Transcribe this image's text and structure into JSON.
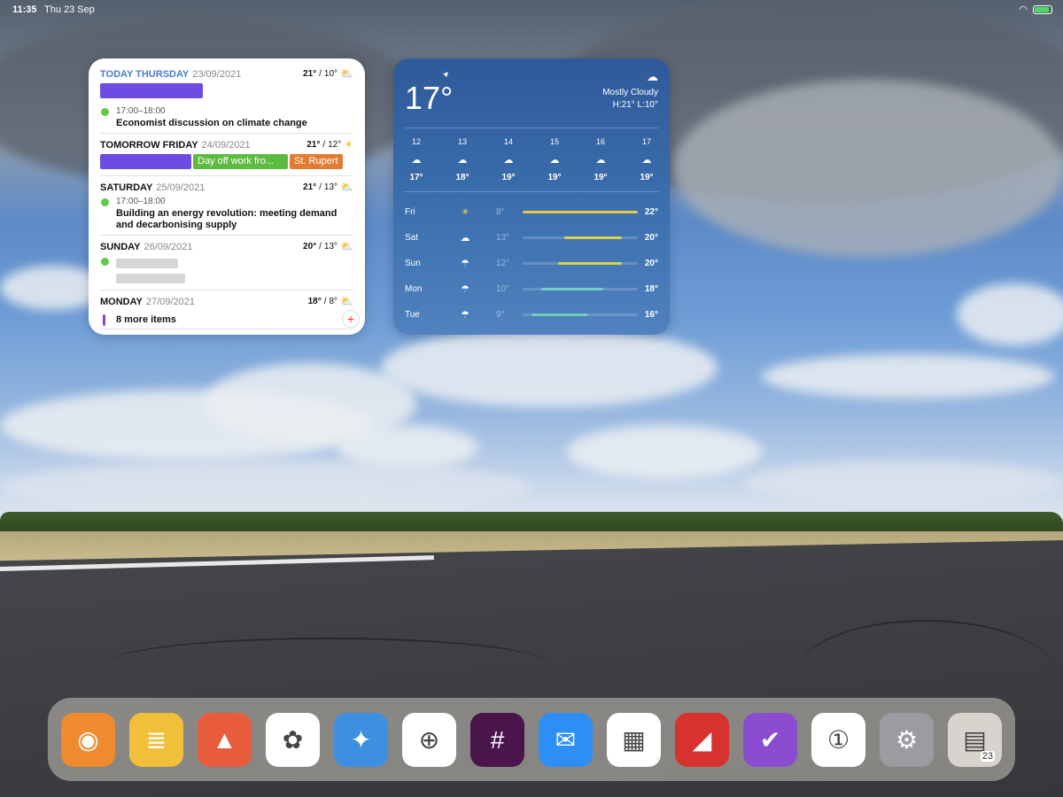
{
  "status": {
    "time": "11:35",
    "date": "Thu 23 Sep"
  },
  "calendar": {
    "days": [
      {
        "name": "TODAY THURSDAY",
        "date": "23/09/2021",
        "hi": "21°",
        "lo": "10°",
        "icon": "partly-cloudy-icon",
        "events": [
          {
            "time": "17:00–18:00",
            "title": "Economist discussion on climate change"
          }
        ]
      },
      {
        "name": "TOMORROW FRIDAY",
        "date": "24/09/2021",
        "hi": "21°",
        "lo": "12°",
        "icon": "sun-icon",
        "pills": [
          "Day off work fro...",
          "St. Rupert"
        ]
      },
      {
        "name": "SATURDAY",
        "date": "25/09/2021",
        "hi": "21°",
        "lo": "13°",
        "icon": "partly-cloudy-icon",
        "events": [
          {
            "time": "17:00–18:00",
            "title": "Building an energy revolution: meeting demand and decarbonising supply"
          }
        ]
      },
      {
        "name": "SUNDAY",
        "date": "26/09/2021",
        "hi": "20°",
        "lo": "13°",
        "icon": "partly-cloudy-icon"
      },
      {
        "name": "MONDAY",
        "date": "27/09/2021",
        "hi": "18°",
        "lo": "8°",
        "icon": "partly-cloudy-icon",
        "more": "8 more items"
      }
    ]
  },
  "weather": {
    "current": "17°",
    "condition": "Mostly Cloudy",
    "hilo": "H:21° L:10°",
    "hourly": [
      {
        "hour": "12",
        "temp": "17°"
      },
      {
        "hour": "13",
        "temp": "18°"
      },
      {
        "hour": "14",
        "temp": "19°"
      },
      {
        "hour": "15",
        "temp": "19°"
      },
      {
        "hour": "16",
        "temp": "19°"
      },
      {
        "hour": "17",
        "temp": "19°"
      }
    ],
    "daily": [
      {
        "day": "Fri",
        "lo": "8°",
        "hi": "22°",
        "icon": "sun-icon",
        "range": [
          0,
          1
        ],
        "color": "#e7c94a"
      },
      {
        "day": "Sat",
        "lo": "13°",
        "hi": "20°",
        "icon": "cloud-icon",
        "range": [
          0.36,
          0.86
        ],
        "color": "#d6d24a"
      },
      {
        "day": "Sun",
        "lo": "12°",
        "hi": "20°",
        "icon": "rain-cloud-icon",
        "range": [
          0.31,
          0.86
        ],
        "color": "#d6d24a"
      },
      {
        "day": "Mon",
        "lo": "10°",
        "hi": "18°",
        "icon": "rain-cloud-icon",
        "range": [
          0.16,
          0.7
        ],
        "color": "#6fd0c0"
      },
      {
        "day": "Tue",
        "lo": "9°",
        "hi": "16°",
        "icon": "rain-cloud-icon",
        "range": [
          0.08,
          0.56
        ],
        "color": "#6fd0c0"
      }
    ]
  },
  "dock": {
    "apps": [
      {
        "name": "overcast-icon",
        "bg": "#f08a2e",
        "glyph": "◉"
      },
      {
        "name": "notes-list-icon",
        "bg": "#f2bf3a",
        "glyph": "≣"
      },
      {
        "name": "ascent-icon",
        "bg": "#e85c3e",
        "glyph": "▲"
      },
      {
        "name": "photos-icon",
        "bg": "#ffffff",
        "glyph": "✿"
      },
      {
        "name": "pdf-expert-icon",
        "bg": "#3d8fe0",
        "glyph": "✦"
      },
      {
        "name": "safari-icon",
        "bg": "#ffffff",
        "glyph": "⊕"
      },
      {
        "name": "slack-icon",
        "bg": "#4a154b",
        "glyph": "#"
      },
      {
        "name": "mail-icon",
        "bg": "#2d8ef3",
        "glyph": "✉"
      },
      {
        "name": "fantastical-icon",
        "bg": "#ffffff",
        "glyph": "▦"
      },
      {
        "name": "bear-icon",
        "bg": "#d8322f",
        "glyph": "◢"
      },
      {
        "name": "omnifocus-icon",
        "bg": "#8b4ccf",
        "glyph": "✔"
      },
      {
        "name": "1password-icon",
        "bg": "#ffffff",
        "glyph": "①"
      },
      {
        "name": "settings-icon",
        "bg": "#9a9ca2",
        "glyph": "⚙"
      },
      {
        "name": "app-library-icon",
        "bg": "#d7d4ce",
        "glyph": "▤"
      }
    ],
    "library_date": "23"
  }
}
